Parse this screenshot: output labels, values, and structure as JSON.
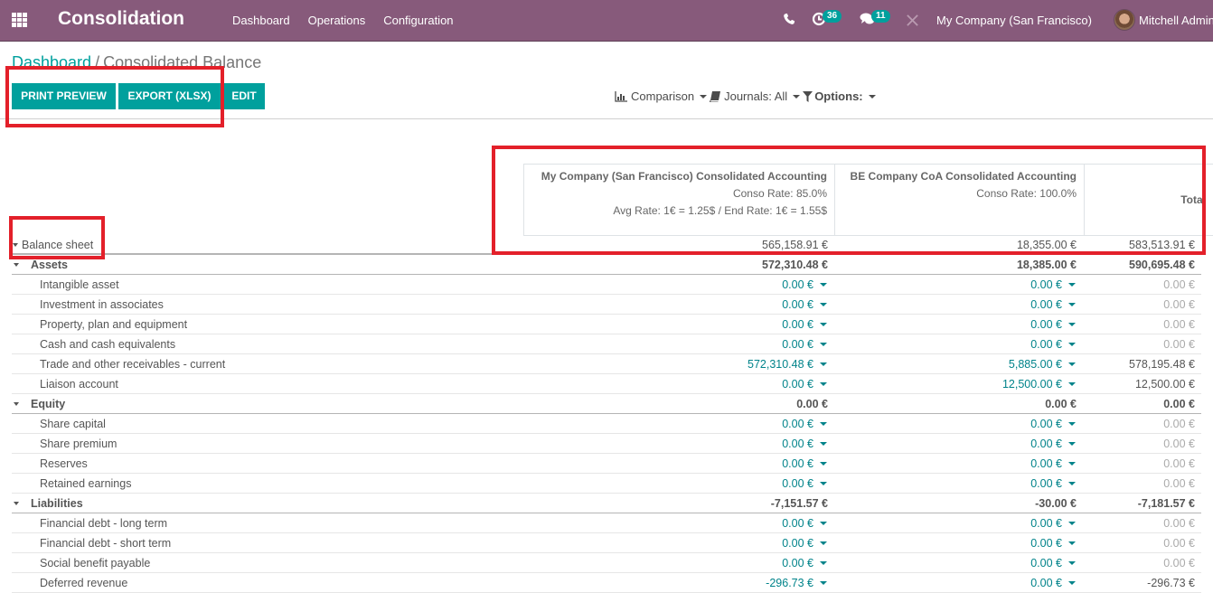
{
  "navbar": {
    "app_title": "Consolidation",
    "menu": [
      "Dashboard",
      "Operations",
      "Configuration"
    ],
    "activity_count": "36",
    "messages_count": "11",
    "company": "My Company (San Francisco)",
    "user": "Mitchell Admin",
    "brand_color": "#875a7b"
  },
  "breadcrumb": {
    "parent": "Dashboard",
    "separator": "/",
    "current": "Consolidated Balance"
  },
  "buttons": {
    "print_preview": "PRINT PREVIEW",
    "export": "EXPORT (XLSX)",
    "edit": "EDIT"
  },
  "filters": {
    "comparison": "Comparison",
    "journals": "Journals: All",
    "options": "Options:"
  },
  "columns": [
    {
      "title": "My Company (San Francisco) Consolidated Accounting",
      "line1": "Conso Rate: 85.0%",
      "line2": "Avg Rate: 1€ = 1.25$ / End Rate: 1€ = 1.55$"
    },
    {
      "title": "BE Company CoA Consolidated Accounting",
      "line1": "Conso Rate: 100.0%",
      "line2": ""
    },
    {
      "title": "Total"
    }
  ],
  "rows": [
    {
      "label": "Balance sheet",
      "type": "top",
      "values": [
        "565,158.91 €",
        "18,355.00 €",
        "583,513.91 €"
      ]
    },
    {
      "label": "Assets",
      "type": "group",
      "values": [
        "572,310.48 €",
        "18,385.00 €",
        "590,695.48 €"
      ]
    },
    {
      "label": "Intangible asset",
      "type": "child",
      "values": [
        "0.00 €",
        "0.00 €",
        "0.00 €"
      ]
    },
    {
      "label": "Investment in associates",
      "type": "child",
      "values": [
        "0.00 €",
        "0.00 €",
        "0.00 €"
      ]
    },
    {
      "label": "Property, plan and equipment",
      "type": "child",
      "values": [
        "0.00 €",
        "0.00 €",
        "0.00 €"
      ]
    },
    {
      "label": "Cash and cash equivalents",
      "type": "child",
      "values": [
        "0.00 €",
        "0.00 €",
        "0.00 €"
      ]
    },
    {
      "label": "Trade and other receivables - current",
      "type": "child",
      "values": [
        "572,310.48 €",
        "5,885.00 €",
        "578,195.48 €"
      ]
    },
    {
      "label": "Liaison account",
      "type": "child",
      "values": [
        "0.00 €",
        "12,500.00 €",
        "12,500.00 €"
      ]
    },
    {
      "label": "Equity",
      "type": "group",
      "values": [
        "0.00 €",
        "0.00 €",
        "0.00 €"
      ]
    },
    {
      "label": "Share capital",
      "type": "child",
      "values": [
        "0.00 €",
        "0.00 €",
        "0.00 €"
      ]
    },
    {
      "label": "Share premium",
      "type": "child",
      "values": [
        "0.00 €",
        "0.00 €",
        "0.00 €"
      ]
    },
    {
      "label": "Reserves",
      "type": "child",
      "values": [
        "0.00 €",
        "0.00 €",
        "0.00 €"
      ]
    },
    {
      "label": "Retained earnings",
      "type": "child",
      "values": [
        "0.00 €",
        "0.00 €",
        "0.00 €"
      ]
    },
    {
      "label": "Liabilities",
      "type": "group",
      "values": [
        "-7,151.57 €",
        "-30.00 €",
        "-7,181.57 €"
      ]
    },
    {
      "label": "Financial debt - long term",
      "type": "child",
      "values": [
        "0.00 €",
        "0.00 €",
        "0.00 €"
      ]
    },
    {
      "label": "Financial debt - short term",
      "type": "child",
      "values": [
        "0.00 €",
        "0.00 €",
        "0.00 €"
      ]
    },
    {
      "label": "Social benefit payable",
      "type": "child",
      "values": [
        "0.00 €",
        "0.00 €",
        "0.00 €"
      ]
    },
    {
      "label": "Deferred revenue",
      "type": "child",
      "values": [
        "-296.73 €",
        "0.00 €",
        "-296.73 €"
      ]
    }
  ]
}
